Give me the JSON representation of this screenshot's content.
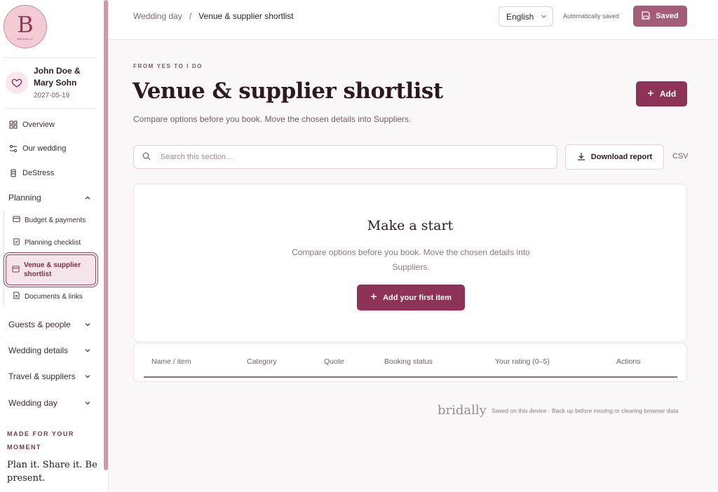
{
  "brand": {
    "logo_letter": "B",
    "logo_sub": "BRIDALLY",
    "footer_name": "bridally"
  },
  "couple": {
    "names": "John Doe & Mary Sohn",
    "date": "2027-05-19"
  },
  "nav": {
    "overview": "Overview",
    "our_wedding": "Our wedding",
    "destress": "DeStress",
    "planning": "Planning",
    "sub": {
      "budget": "Budget & payments",
      "checklist": "Planning checklist",
      "shortlist": "Venue & supplier shortlist",
      "documents": "Documents & links"
    },
    "guests": "Guests & people",
    "details": "Wedding details",
    "travel": "Travel & suppliers",
    "day": "Wedding day"
  },
  "sidebar_footer": {
    "made_for": "MADE FOR YOUR MOMENT",
    "tagline": "Plan it. Share it. Be present."
  },
  "topbar": {
    "crumb_parent": "Wedding day",
    "crumb_sep": "/",
    "crumb_current": "Venue & supplier shortlist",
    "language": "English",
    "autosave": "Automatically saved",
    "saved": "Saved"
  },
  "main": {
    "eyebrow": "FROM YES TO I DO",
    "title": "Venue & supplier shortlist",
    "add": "Add",
    "subtitle": "Compare options before you book. Move the chosen details into Suppliers.",
    "search_placeholder": "Search this section…",
    "download": "Download report",
    "csv": "CSV",
    "empty_title": "Make a start",
    "empty_desc": "Compare options before you book. Move the chosen details into Suppliers.",
    "first_item": "Add your first item"
  },
  "table": {
    "headers": [
      "Name / item",
      "Category",
      "Quote",
      "Booking status",
      "Your rating (0–5)",
      "Actions"
    ]
  },
  "footer": {
    "note": "Saved on this device · Back up before moving or clearing browser data"
  },
  "colors": {
    "accent": "#8e3358",
    "saved": "#a45d78",
    "active_bg": "#f5e4ea"
  }
}
